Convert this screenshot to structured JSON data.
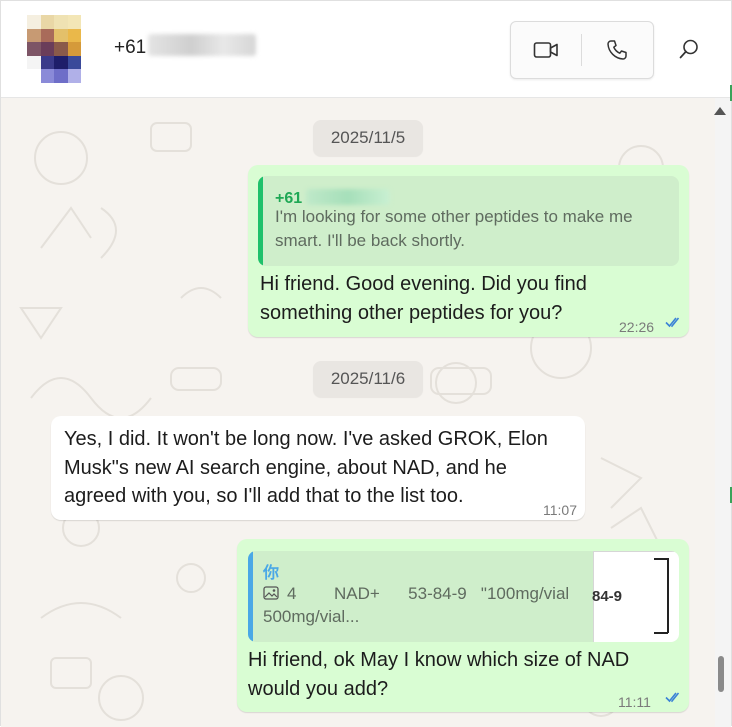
{
  "header": {
    "contact_name": "+61",
    "avatar_colors": [
      "#f5efe0",
      "#e9d7a6",
      "#efe2b3",
      "#f3e6b6",
      "#ffffff",
      "#c79a73",
      "#a96b5a",
      "#e3c06a",
      "#eab84a",
      "#ffffff",
      "#7d5566",
      "#6a3d5a",
      "#8a5a4a",
      "#d59a3a",
      "#ffffff",
      "#f4f4f4",
      "#3a3a8a",
      "#1e1e6a",
      "#3a4a9a",
      "#ffffff",
      "#ffffff",
      "#8a8ad8",
      "#6e6ec8",
      "#b0b0e8",
      "#ffffff"
    ]
  },
  "messages": {
    "date1": "2025/11/5",
    "msg1": {
      "quote_name": "+61",
      "quote_text_1": "I'm looking for some other peptides to make me",
      "quote_text_2": "smart. I'll be back shortly.",
      "line1": "Hi friend. Good evening. Did you find",
      "line2": "something other peptides for you?",
      "time": "22:26"
    },
    "date2": "2025/11/6",
    "msg2": {
      "line1": "Yes, I did. It won't be long now. I've asked GROK, Elon",
      "line2": "Musk\"s new AI search engine, about NAD, and he",
      "line3": "agreed with you, so I'll add that to the list too.",
      "time": "11:07"
    },
    "msg3": {
      "quote_name": "你",
      "quote_count": "4",
      "quote_line1_rest": "NAD+      53-84-9   \"100mg/vial",
      "quote_line2": "500mg/vial...",
      "thumb_text": "84-9",
      "line1": "Hi friend, ok May I know which size of NAD",
      "line2": "would you add?",
      "time": "11:11"
    }
  },
  "colors": {
    "outgoing_bubble": "#d9fdd3",
    "incoming_bubble": "#ffffff",
    "quote_bar_green": "#1fc16b",
    "quote_bar_blue": "#4aa8e6",
    "quote_name_green": "#1fa855",
    "quote_name_blue": "#4aa8e6",
    "read_ticks": "#3b82d6"
  },
  "icons": {
    "video": "video-camera-icon",
    "phone": "phone-icon",
    "search": "search-icon",
    "image": "image-icon",
    "read": "double-check-icon"
  }
}
